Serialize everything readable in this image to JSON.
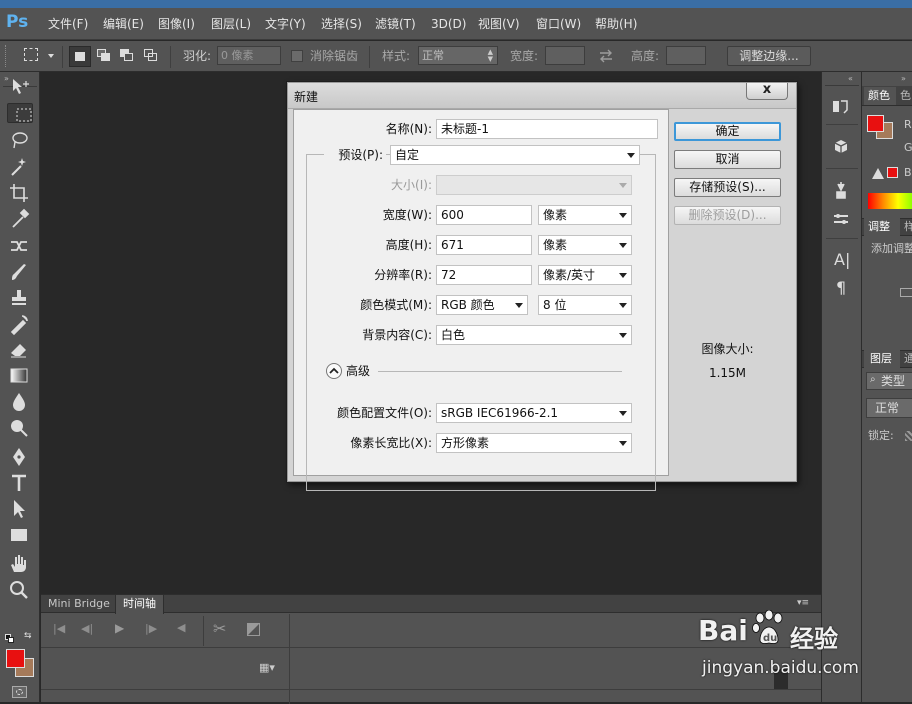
{
  "app": {
    "logo": "Ps"
  },
  "menu": [
    "文件(F)",
    "编辑(E)",
    "图像(I)",
    "图层(L)",
    "文字(Y)",
    "选择(S)",
    "滤镜(T)",
    "3D(D)",
    "视图(V)",
    "窗口(W)",
    "帮助(H)"
  ],
  "options": {
    "feather_label": "羽化:",
    "feather_value": "0 像素",
    "antialias_label": "消除锯齿",
    "style_label": "样式:",
    "style_value": "正常",
    "width_label": "宽度:",
    "height_label": "高度:",
    "refine_edge": "调整边缘..."
  },
  "timeline": {
    "tabs": [
      "Mini Bridge",
      "时间轴"
    ]
  },
  "panels": {
    "color_tab": "颜色",
    "color_tab2": "色",
    "rgb_r": "R",
    "rgb_g": "G",
    "rgb_b": "B",
    "adjust_tab": "调整",
    "adjust_tab2": "样",
    "adjust_add": "添加调整",
    "layers_tab": "图层",
    "layers_tab2": "通",
    "layer_search": "类型",
    "blend_mode": "正常",
    "lock_label": "锁定:"
  },
  "dialog": {
    "title": "新建",
    "close": "x",
    "name_label": "名称(N):",
    "name_value": "未标题-1",
    "preset_label": "预设(P):",
    "preset_value": "自定",
    "size_label": "大小(I):",
    "width_label": "宽度(W):",
    "width_value": "600",
    "width_unit": "像素",
    "height_label": "高度(H):",
    "height_value": "671",
    "height_unit": "像素",
    "resolution_label": "分辨率(R):",
    "resolution_value": "72",
    "resolution_unit": "像素/英寸",
    "color_mode_label": "颜色模式(M):",
    "color_mode_value": "RGB 颜色",
    "bit_depth_value": "8 位",
    "background_label": "背景内容(C):",
    "background_value": "白色",
    "advanced_label": "高级",
    "profile_label": "颜色配置文件(O):",
    "profile_value": "sRGB IEC61966-2.1",
    "aspect_label": "像素长宽比(X):",
    "aspect_value": "方形像素",
    "ok": "确定",
    "cancel": "取消",
    "save_preset": "存储预设(S)...",
    "delete_preset": "删除预设(D)...",
    "image_size_label": "图像大小:",
    "image_size_value": "1.15M"
  },
  "colors": {
    "foreground": "#e81010",
    "background": "#a57a5a",
    "accent": "#5fb3f0"
  },
  "watermark": {
    "brand": "Bai",
    "brand2": "du",
    "brand_cn": "经验",
    "url": "jingyan.baidu.com"
  }
}
